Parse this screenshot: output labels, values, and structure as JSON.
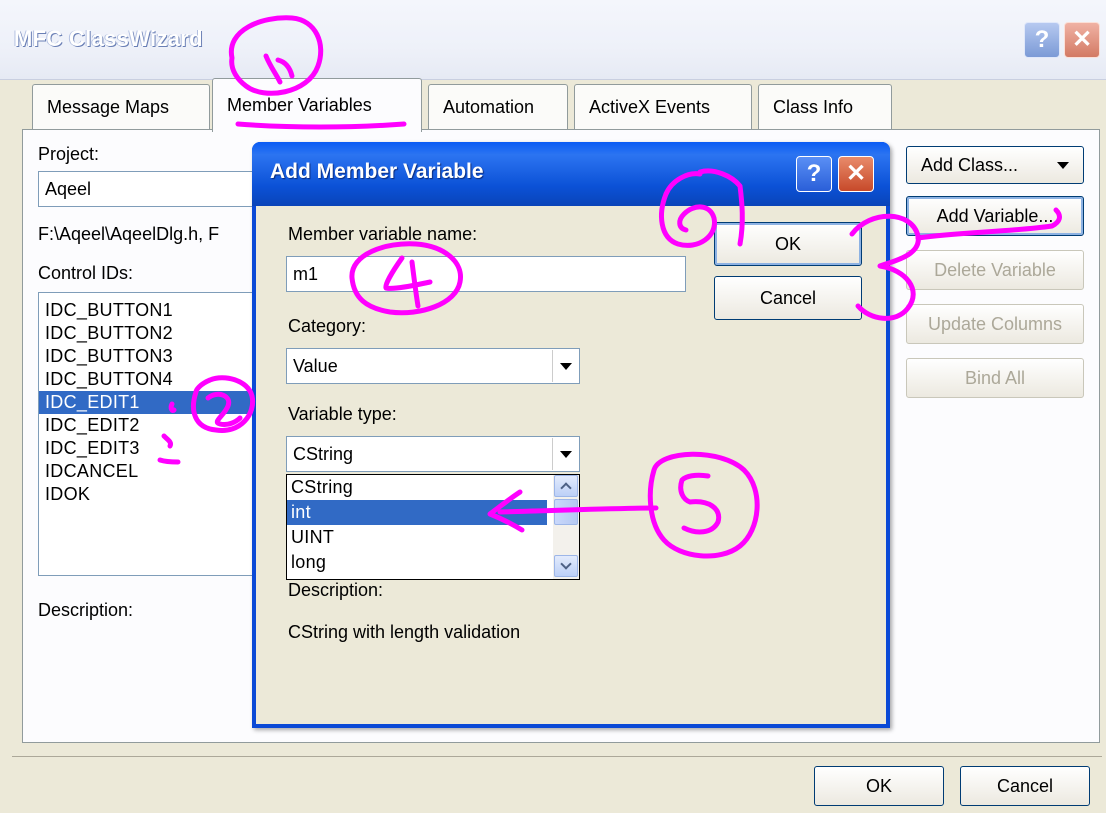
{
  "outer_window": {
    "title": "MFC ClassWizard",
    "help_glyph": "?",
    "close_glyph": "✕"
  },
  "tabs": [
    {
      "label": "Message Maps",
      "active": false
    },
    {
      "label": "Member Variables",
      "active": true
    },
    {
      "label": "Automation",
      "active": false
    },
    {
      "label": "ActiveX Events",
      "active": false
    },
    {
      "label": "Class Info",
      "active": false
    }
  ],
  "left_panel": {
    "project_label": "Project:",
    "project_value": "Aqeel",
    "file_path": "F:\\Aqeel\\AqeelDlg.h, F",
    "control_ids_label": "Control IDs:",
    "control_ids": [
      "IDC_BUTTON1",
      "IDC_BUTTON2",
      "IDC_BUTTON3",
      "IDC_BUTTON4",
      "IDC_EDIT1",
      "IDC_EDIT2",
      "IDC_EDIT3",
      "IDCANCEL",
      "IDOK"
    ],
    "selected_control": "IDC_EDIT1",
    "description_label": "Description:"
  },
  "right_buttons": {
    "add_class": "Add Class...",
    "add_variable": "Add Variable...",
    "delete_variable": "Delete Variable",
    "update_columns": "Update Columns",
    "bind_all": "Bind All"
  },
  "bottom_buttons": {
    "ok": "OK",
    "cancel": "Cancel"
  },
  "dialog": {
    "title": "Add Member Variable",
    "name_label": "Member variable name:",
    "name_value": "m1",
    "category_label": "Category:",
    "category_value": "Value",
    "type_label": "Variable type:",
    "type_value": "CString",
    "type_options": [
      "CString",
      "int",
      "UINT",
      "long"
    ],
    "type_highlighted": "int",
    "description_label": "Description:",
    "description_value": "CString with length validation",
    "ok": "OK",
    "cancel": "Cancel"
  },
  "annotation_color": "#ff00ff",
  "annotations": [
    "1",
    "2",
    "3",
    "4",
    "5",
    "6"
  ]
}
